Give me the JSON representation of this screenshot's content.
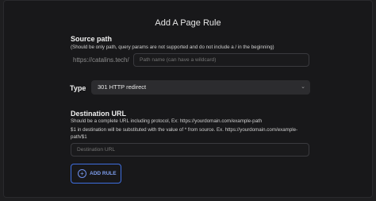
{
  "modal": {
    "title": "Add A Page Rule"
  },
  "source": {
    "label": "Source path",
    "hint": "(Should be only path, query params are not supported and do not include a / in the beginning)",
    "prefix": "https://catalins.tech/",
    "placeholder": "Path name (can have a wildcard)"
  },
  "type": {
    "label": "Type",
    "selected": "301 HTTP redirect"
  },
  "destination": {
    "label": "Destination URL",
    "hint1": "Should be a complete URL including protocol, Ex: https://yourdomain.com/example-path",
    "hint2_line1": "$1 in destination will be substituted with the value of * from source. Ex. https://yourdomain.com/example-",
    "hint2_line2": "path/$1",
    "placeholder": "Destination URL"
  },
  "actions": {
    "add_rule_label": "ADD RULE"
  },
  "colors": {
    "accent": "#3f6fe0",
    "panel_bg": "#18181a"
  }
}
